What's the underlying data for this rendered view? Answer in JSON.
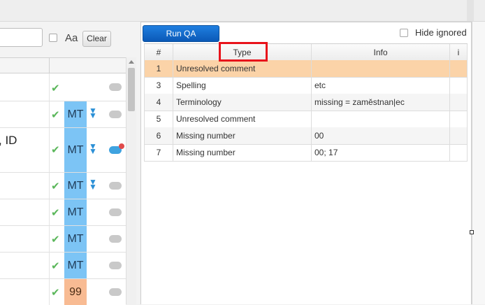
{
  "left_panel": {
    "aa_label": "Aa",
    "clear_label": "Clear",
    "segment_partial_text": ", ID",
    "rows": [
      {
        "confirmed": true,
        "match": "",
        "bubble": "gray"
      },
      {
        "confirmed": true,
        "match": "MT",
        "expand": true,
        "bubble": "gray"
      },
      {
        "confirmed": true,
        "match": "MT",
        "expand": true,
        "bubble": "blue-error"
      },
      {
        "confirmed": true,
        "match": "MT",
        "expand": true,
        "bubble": "gray"
      },
      {
        "confirmed": true,
        "match": "MT",
        "bubble": "gray"
      },
      {
        "confirmed": true,
        "match": "MT",
        "bubble": "gray"
      },
      {
        "confirmed": true,
        "match": "MT",
        "bubble": "gray"
      },
      {
        "confirmed": true,
        "match": "99",
        "bubble": "gray"
      }
    ],
    "icons": {
      "check": "check-icon",
      "expand": "double-chevron-down-icon",
      "comment": "comment-bubble-icon"
    },
    "colors": {
      "mt": "#7cc4f5",
      "fuzzy": "#f8bb93",
      "check": "#5bb75b"
    }
  },
  "qa_panel": {
    "run_button": "Run QA",
    "hide_ignored_label": "Hide ignored",
    "columns": [
      "#",
      "Type",
      "Info",
      "i"
    ],
    "rows": [
      {
        "num": "1",
        "type": "Unresolved comment",
        "info": "",
        "i": ""
      },
      {
        "num": "3",
        "type": "Spelling",
        "info": "etc",
        "i": ""
      },
      {
        "num": "4",
        "type": "Terminology",
        "info": "missing = zaměstnan|ec",
        "i": ""
      },
      {
        "num": "5",
        "type": "Unresolved comment",
        "info": "",
        "i": ""
      },
      {
        "num": "6",
        "type": "Missing number",
        "info": "00",
        "i": ""
      },
      {
        "num": "7",
        "type": "Missing number",
        "info": "00; 17",
        "i": ""
      }
    ],
    "highlight_color": "#fbd3a8",
    "annotation_color": "#e8131b"
  }
}
